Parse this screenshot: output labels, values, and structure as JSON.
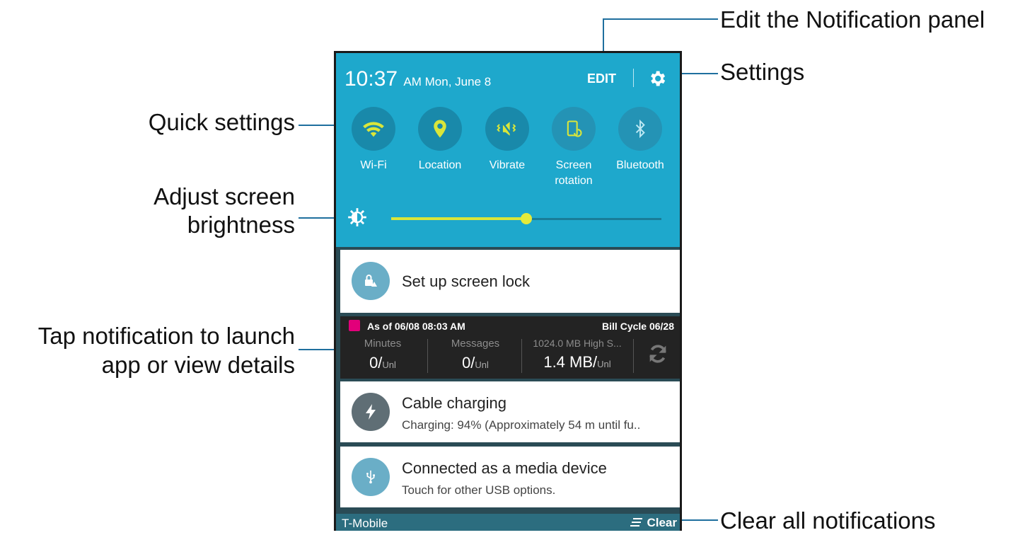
{
  "callouts": {
    "edit_panel": "Edit the Notification panel",
    "settings": "Settings",
    "quick_settings": "Quick settings",
    "brightness_line1": "Adjust screen",
    "brightness_line2": "brightness",
    "tap_line1": "Tap notification to launch",
    "tap_line2": "app or view details",
    "clear_all": "Clear all notifications"
  },
  "status": {
    "time": "10:37",
    "date": "AM Mon, June 8",
    "edit": "EDIT"
  },
  "quick_settings": [
    {
      "label": "Wi-Fi",
      "icon": "wifi-icon",
      "on": true
    },
    {
      "label": "Location",
      "icon": "location-icon",
      "on": true
    },
    {
      "label": "Vibrate",
      "icon": "vibrate-icon",
      "on": true
    },
    {
      "label": "Screen rotation",
      "icon": "screen-rotation-icon",
      "on": false
    },
    {
      "label": "Bluetooth",
      "icon": "bluetooth-icon",
      "on": false
    }
  ],
  "brightness": {
    "level": 0.5
  },
  "notifications": {
    "screen_lock": {
      "title": "Set up screen lock"
    },
    "tmobile": {
      "as_of": "As of  06/08 08:03 AM",
      "bill_cycle": "Bill Cycle 06/28",
      "minutes_label": "Minutes",
      "minutes_value": "0/",
      "messages_label": "Messages",
      "messages_value": "0/",
      "data_label": "1024.0 MB High S...",
      "data_value": "1.4 MB/",
      "unit": "Unl"
    },
    "charging": {
      "title": "Cable charging",
      "sub": "Charging: 94% (Approximately 54 m until fu.."
    },
    "usb": {
      "title": "Connected as a media device",
      "sub": "Touch for other USB options."
    }
  },
  "footer": {
    "carrier": "T-Mobile",
    "clear": "Clear"
  },
  "colors": {
    "panel": "#1ea8cc",
    "accent": "#d9e63a",
    "line": "#1f6f9e"
  }
}
